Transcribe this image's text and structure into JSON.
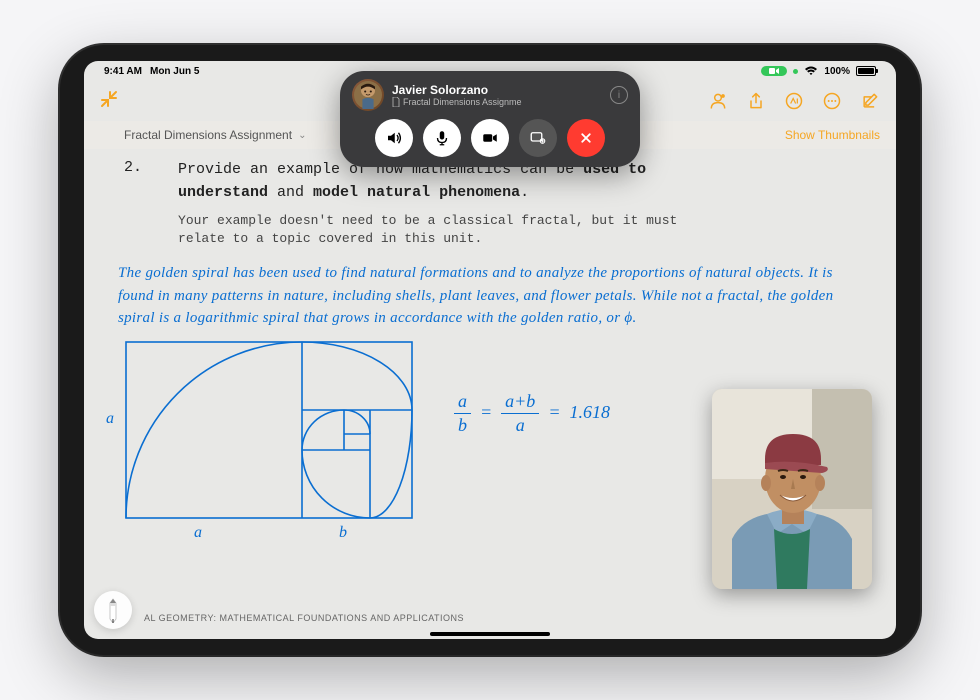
{
  "status": {
    "time": "9:41 AM",
    "date": "Mon Jun 5",
    "battery_pct": "100%"
  },
  "breadcrumb": {
    "title": "Fractal Dimensions Assignment"
  },
  "actions": {
    "show_thumbnails": "Show Thumbnails"
  },
  "facetime": {
    "name": "Javier Solorzano",
    "subtitle": "Fractal Dimensions Assignme"
  },
  "document": {
    "question_number": "2.",
    "question_prefix": "Provide an example of how mathematics can be ",
    "question_bold1": "used to understand",
    "question_mid": " and ",
    "question_bold2": "model natural phenomena",
    "question_suffix": ".",
    "subtext": "Your example doesn't need to be a classical fractal, but it must relate to a topic covered in this unit.",
    "handwritten_answer": "The golden spiral has been used to find natural formations and to analyze the proportions of natural objects. It is found in many patterns in nature, including shells, plant leaves, and flower petals. While not a fractal, the golden spiral is a logarithmic spiral that grows in accordance with the golden ratio, or ϕ.",
    "axis_a": "a",
    "axis_b": "b",
    "eq_a": "a",
    "eq_b": "b",
    "eq_ab": "a+b",
    "eq_a2": "a",
    "eq_result": "1.618",
    "footer": "AL GEOMETRY: MATHEMATICAL FOUNDATIONS AND APPLICATIONS"
  },
  "colors": {
    "accent": "#f5a623",
    "ink": "#0a6ed1"
  }
}
